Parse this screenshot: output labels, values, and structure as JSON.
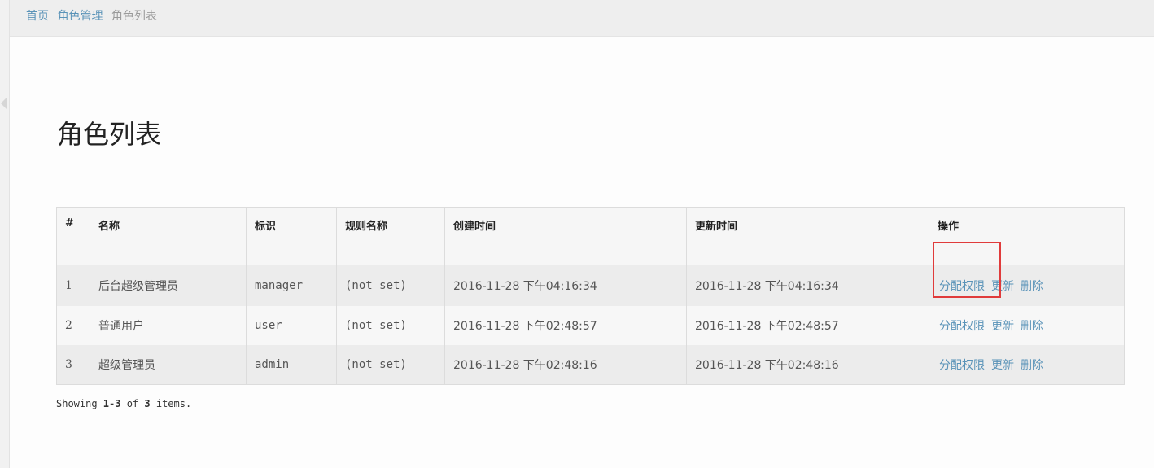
{
  "breadcrumb": {
    "home": "首页",
    "parent": "角色管理",
    "current": "角色列表"
  },
  "page": {
    "title": "角色列表"
  },
  "table": {
    "headers": [
      "#",
      "名称",
      "标识",
      "规则名称",
      "创建时间",
      "更新时间",
      "操作"
    ],
    "rows": [
      {
        "index": "1",
        "name": "后台超级管理员",
        "key": "manager",
        "rule": "(not set)",
        "created": "2016-11-28 下午04:16:34",
        "updated": "2016-11-28 下午04:16:34"
      },
      {
        "index": "2",
        "name": "普通用户",
        "key": "user",
        "rule": "(not set)",
        "created": "2016-11-28 下午02:48:57",
        "updated": "2016-11-28 下午02:48:57"
      },
      {
        "index": "3",
        "name": "超级管理员",
        "key": "admin",
        "rule": "(not set)",
        "created": "2016-11-28 下午02:48:16",
        "updated": "2016-11-28 下午02:48:16"
      }
    ],
    "actions": {
      "assign": "分配权限",
      "update": "更新",
      "delete": "删除"
    }
  },
  "summary": {
    "prefix": "Showing ",
    "range": "1-3",
    "of": " of ",
    "total": "3",
    "suffix": " items."
  },
  "colors": {
    "link": "#5a93b8",
    "highlight": "#e03b3b"
  }
}
